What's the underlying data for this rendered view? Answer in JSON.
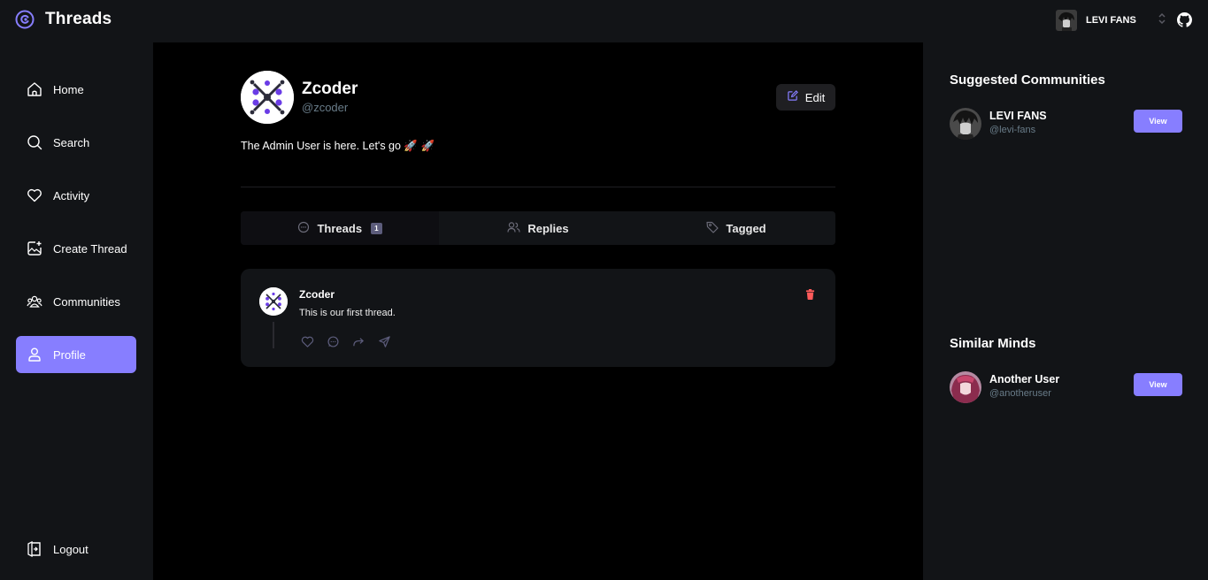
{
  "app": {
    "title": "Threads"
  },
  "topbar": {
    "org_name": "LEVI FANS"
  },
  "sidebar": {
    "items": [
      {
        "label": "Home",
        "icon": "home-icon"
      },
      {
        "label": "Search",
        "icon": "search-icon"
      },
      {
        "label": "Activity",
        "icon": "heart-icon"
      },
      {
        "label": "Create Thread",
        "icon": "create-thread-icon"
      },
      {
        "label": "Communities",
        "icon": "communities-icon"
      },
      {
        "label": "Profile",
        "icon": "user-icon",
        "active": true
      }
    ],
    "logout_label": "Logout"
  },
  "profile": {
    "name": "Zcoder",
    "handle": "@zcoder",
    "bio": "The Admin User is here. Let's go 🚀 🚀",
    "edit_label": "Edit"
  },
  "tabs": [
    {
      "label": "Threads",
      "count": "1",
      "icon": "chat-bubble-icon",
      "active": true
    },
    {
      "label": "Replies",
      "icon": "members-icon"
    },
    {
      "label": "Tagged",
      "icon": "tag-icon"
    }
  ],
  "thread": {
    "author": "Zcoder",
    "text": "This is our first thread."
  },
  "right": {
    "communities_title": "Suggested Communities",
    "communities": [
      {
        "name": "LEVI FANS",
        "handle": "@levi-fans",
        "button": "View"
      }
    ],
    "minds_title": "Similar Minds",
    "minds": [
      {
        "name": "Another User",
        "handle": "@anotheruser",
        "button": "View"
      }
    ]
  },
  "colors": {
    "accent": "#877eff",
    "background": "#121417",
    "main": "#000000",
    "muted": "#697c89",
    "danger": "#ff5a5a"
  }
}
